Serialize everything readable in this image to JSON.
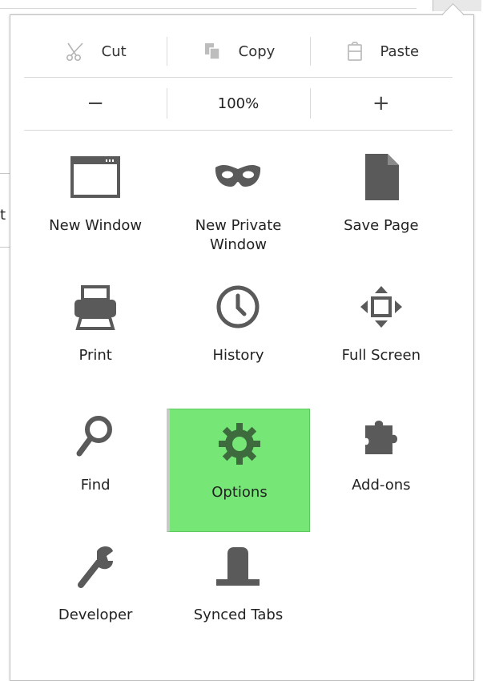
{
  "edit_row": {
    "cut_label": "Cut",
    "copy_label": "Copy",
    "paste_label": "Paste"
  },
  "zoom_row": {
    "zoom_out_label": "−",
    "zoom_level": "100%",
    "zoom_in_label": "+"
  },
  "background": {
    "partial_text": "t"
  },
  "menu_items": [
    {
      "id": "new-window",
      "label": "New Window",
      "icon": "window-icon"
    },
    {
      "id": "new-private-window",
      "label": "New Private\nWindow",
      "icon": "mask-icon"
    },
    {
      "id": "save-page",
      "label": "Save Page",
      "icon": "page-icon"
    },
    {
      "id": "print",
      "label": "Print",
      "icon": "printer-icon"
    },
    {
      "id": "history",
      "label": "History",
      "icon": "clock-icon"
    },
    {
      "id": "full-screen",
      "label": "Full Screen",
      "icon": "fullscreen-icon"
    },
    {
      "id": "find",
      "label": "Find",
      "icon": "search-icon"
    },
    {
      "id": "options",
      "label": "Options",
      "icon": "gear-icon",
      "highlighted": true
    },
    {
      "id": "add-ons",
      "label": "Add-ons",
      "icon": "puzzle-icon"
    },
    {
      "id": "developer",
      "label": "Developer",
      "icon": "wrench-icon"
    },
    {
      "id": "synced-tabs",
      "label": "Synced Tabs",
      "icon": "synced-tabs-icon"
    }
  ],
  "colors": {
    "highlight": "#76e676",
    "icon": "#5a5a5a"
  }
}
